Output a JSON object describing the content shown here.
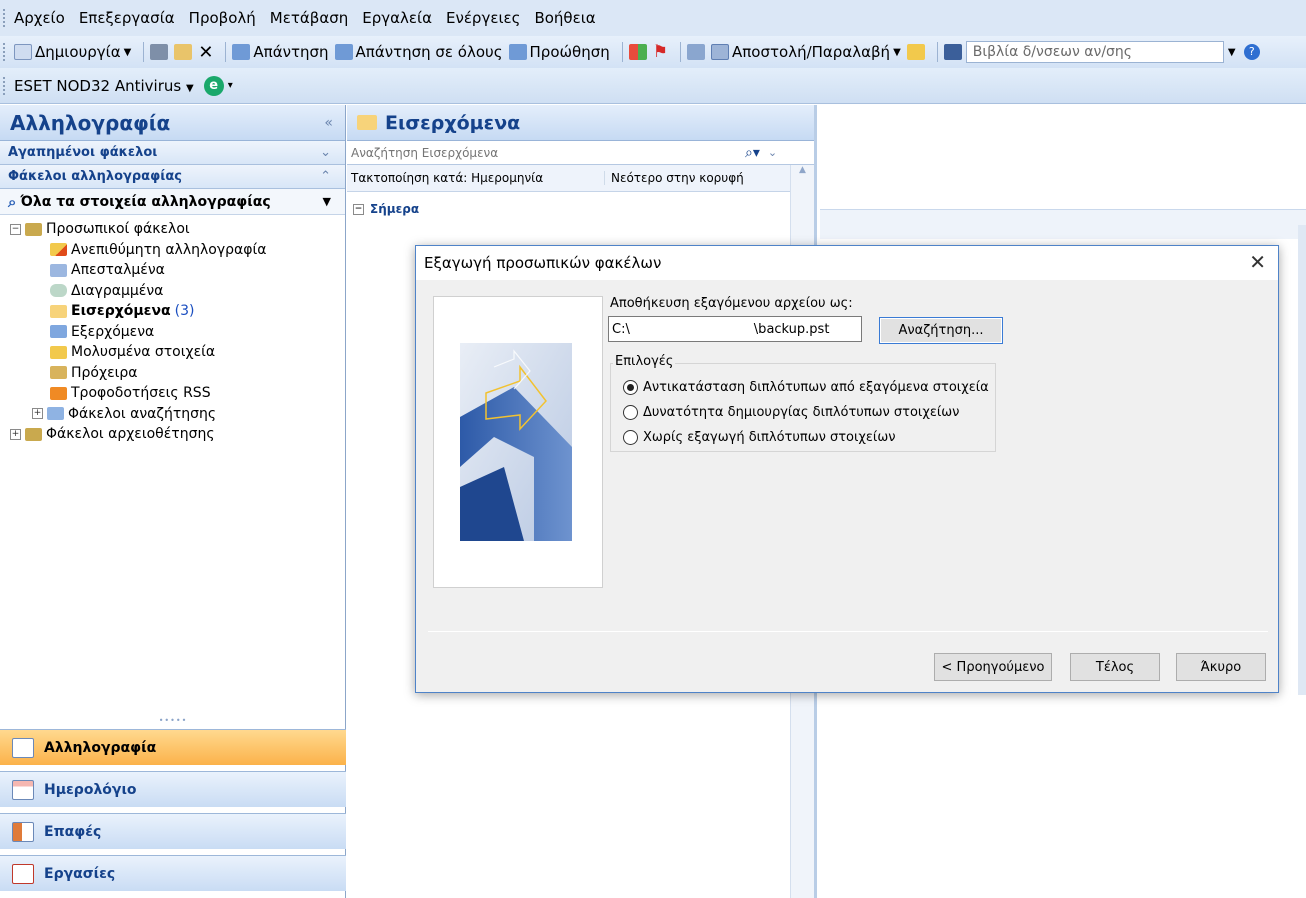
{
  "menu": [
    "Αρχείο",
    "Επεξεργασία",
    "Προβολή",
    "Μετάβαση",
    "Εργαλεία",
    "Ενέργειες",
    "Βοήθεια"
  ],
  "toolbar": {
    "new_label": "Δημιουργία",
    "reply": "Απάντηση",
    "reply_all": "Απάντηση σε όλους",
    "forward": "Προώθηση",
    "send_receive": "Αποστολή/Παραλαβή",
    "addressbook_placeholder": "Βιβλία δ/νσεων αν/σης"
  },
  "toolbar2": {
    "eset": "ESET NOD32 Antivirus"
  },
  "nav": {
    "title": "Αλληλογραφία",
    "favorites": "Αγαπημένοι φάκελοι",
    "mail_folders": "Φάκελοι αλληλογραφίας",
    "all_items": "Όλα τα στοιχεία αλληλογραφίας",
    "tree": {
      "personal": "Προσωπικοί φάκελοι",
      "junk": "Ανεπιθύμητη αλληλογραφία",
      "sent": "Απεσταλμένα",
      "deleted": "Διαγραμμένα",
      "inbox": "Εισερχόμενα",
      "inbox_count": "(3)",
      "outbox": "Εξερχόμενα",
      "infected": "Μολυσμένα στοιχεία",
      "drafts": "Πρόχειρα",
      "rss": "Τροφοδοτήσεις RSS",
      "search": "Φάκελοι αναζήτησης",
      "archive": "Φάκελοι αρχειοθέτησης"
    },
    "buttons": {
      "mail": "Αλληλογραφία",
      "calendar": "Ημερολόγιο",
      "contacts": "Επαφές",
      "tasks": "Εργασίες"
    }
  },
  "inbox": {
    "title": "Εισερχόμενα",
    "search_placeholder": "Αναζήτηση Εισερχόμενα",
    "arrange_by": "Τακτοποίηση κατά: Ημερομηνία",
    "order": "Νεότερο στην κορυφή",
    "group_today": "Σήμερα"
  },
  "dialog": {
    "title": "Εξαγωγή προσωπικών φακέλων",
    "save_label": "Αποθήκευση εξαγόμενου αρχείου ως:",
    "path_value": "C:\\                              \\backup.pst",
    "browse": "Αναζήτηση...",
    "options_label": "Επιλογές",
    "option1": "Αντικατάσταση διπλότυπων από εξαγόμενα στοιχεία",
    "option2": "Δυνατότητα δημιουργίας διπλότυπων στοιχείων",
    "option3": "Χωρίς εξαγωγή διπλότυπων στοιχείων",
    "selected_option": 1,
    "back": "< Προηγούμενο",
    "finish": "Τέλος",
    "cancel": "Άκυρο"
  },
  "colors": {
    "accent": "#15428b",
    "active_nav": "#fbb24a",
    "dialog_border": "#4f83c8"
  }
}
